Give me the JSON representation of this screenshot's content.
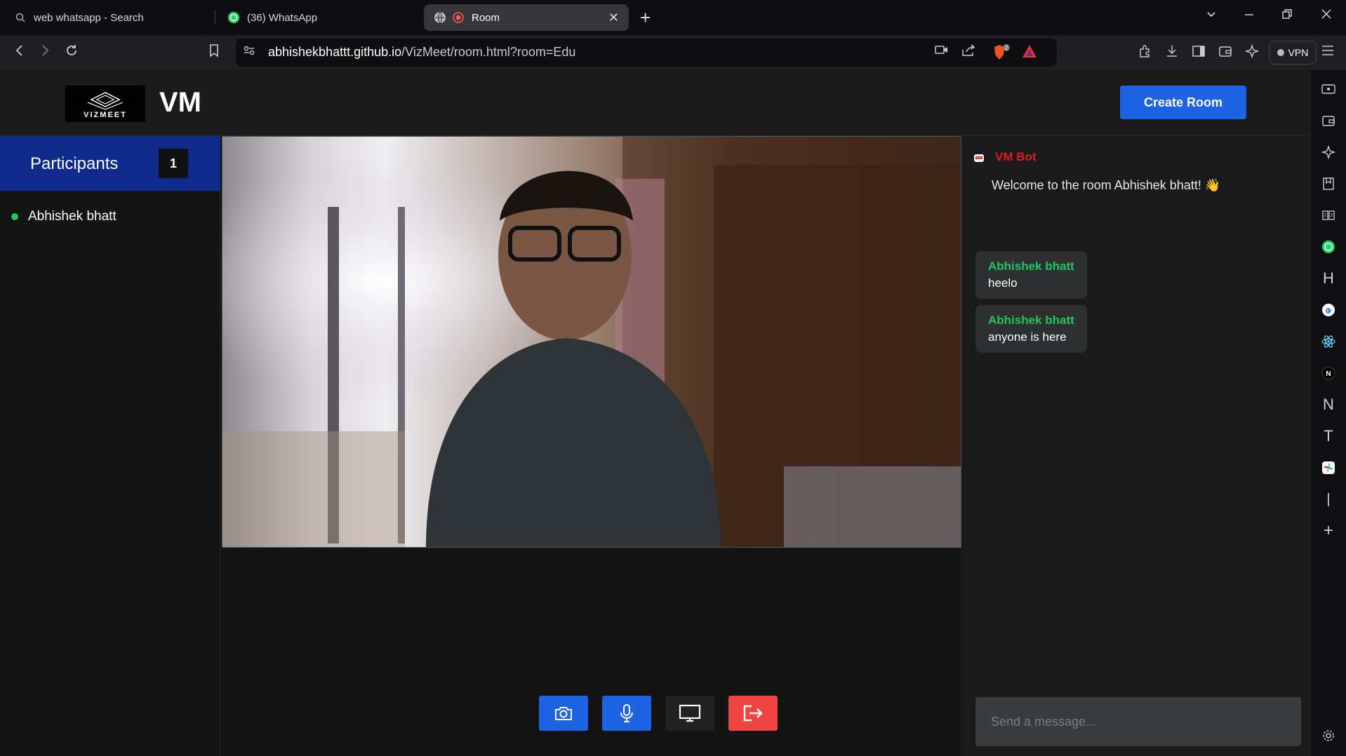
{
  "browser": {
    "tabs": [
      {
        "label": "web whatsapp - Search"
      },
      {
        "label": "(36) WhatsApp"
      },
      {
        "label": "Room"
      }
    ],
    "url_domain": "abhishekbhattt.github.io",
    "url_path": "/VizMeet/room.html?room=Edu",
    "vpn_label": "VPN",
    "shield_count": "2"
  },
  "sidebar_icons": [
    "video-icon",
    "wallet-icon",
    "leo-icon",
    "bookmarks-icon",
    "reading-list-icon",
    "whatsapp-icon",
    "h-icon",
    "google-icon",
    "react-icon",
    "notion-icon",
    "n-icon",
    "t-icon",
    "slack-icon",
    "i-icon",
    "add-icon",
    "settings-icon"
  ],
  "app": {
    "logo_text": "VIZMEET",
    "brand": "VM",
    "create_room_label": "Create Room"
  },
  "participants": {
    "title": "Participants",
    "count": "1",
    "list": [
      {
        "name": "Abhishek bhatt"
      }
    ]
  },
  "chat": {
    "bot_name": "VM Bot",
    "welcome": "Welcome to the room Abhishek bhatt! 👋",
    "messages": [
      {
        "sender": "Abhishek bhatt",
        "text": "heelo"
      },
      {
        "sender": "Abhishek bhatt",
        "text": "anyone is here"
      }
    ],
    "input_placeholder": "Send a message..."
  },
  "controls": {
    "colors": {
      "camera": "#1f63e5",
      "mic": "#1f63e5",
      "screen": "#222222",
      "leave": "#ef4444"
    }
  },
  "colors": {
    "accent": "#1f63e5",
    "participants_header": "#0f2a8a",
    "online": "#22c55e",
    "bot": "#e21b1b"
  }
}
